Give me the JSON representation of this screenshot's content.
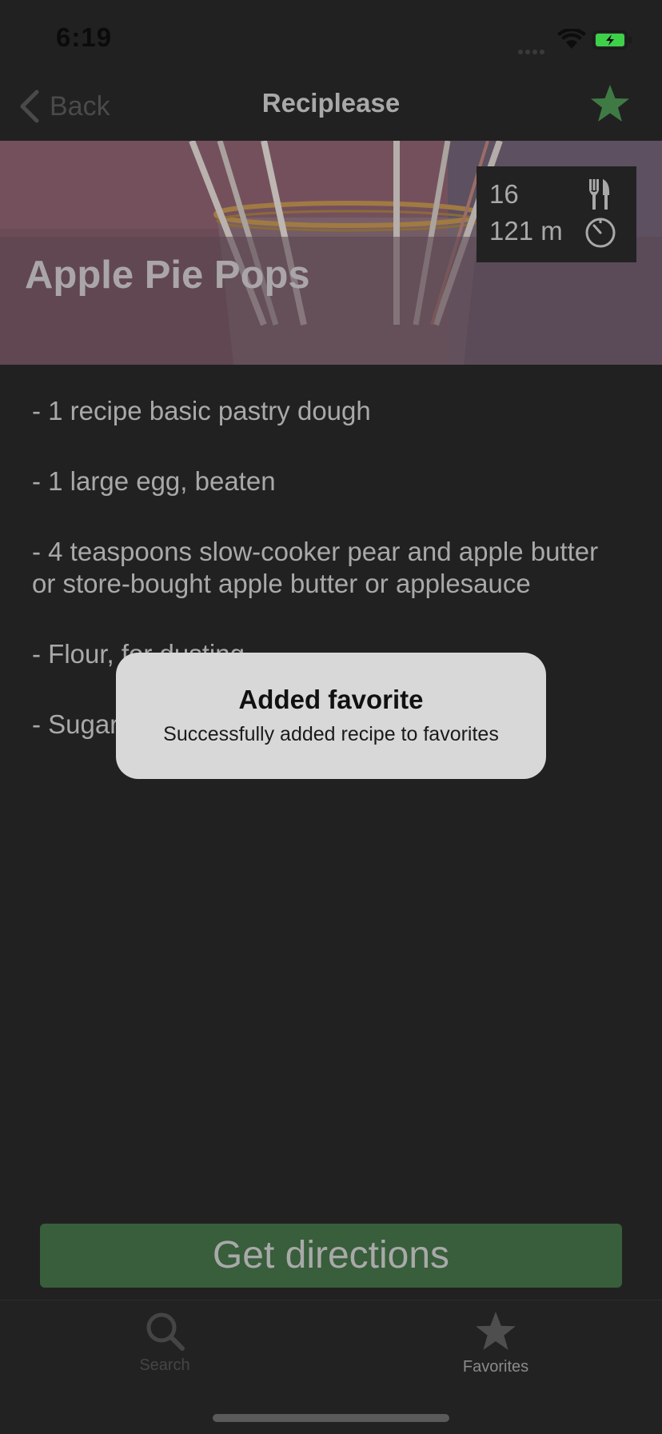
{
  "status_bar": {
    "time": "6:19"
  },
  "nav": {
    "back_label": "Back",
    "title": "Reciplease",
    "favorite_icon": "star-icon",
    "favorite_color": "#3f7a45"
  },
  "recipe": {
    "title": "Apple Pie Pops",
    "servings": "16",
    "duration": "121 m",
    "ingredients": [
      "- 1 recipe basic pastry dough",
      "- 1 large egg, beaten",
      "- 4 teaspoons slow-cooker pear and apple butter or store-bought apple butter or applesauce",
      "- Flour, for dusting",
      "- Sugar"
    ]
  },
  "alert": {
    "title": "Added favorite",
    "message": "Successfully added recipe to favorites"
  },
  "actions": {
    "directions_label": "Get directions",
    "directions_color": "#385e3b"
  },
  "tab_bar": {
    "tabs": [
      {
        "label": "Search",
        "icon": "search-icon"
      },
      {
        "label": "Favorites",
        "icon": "star-icon"
      }
    ]
  }
}
